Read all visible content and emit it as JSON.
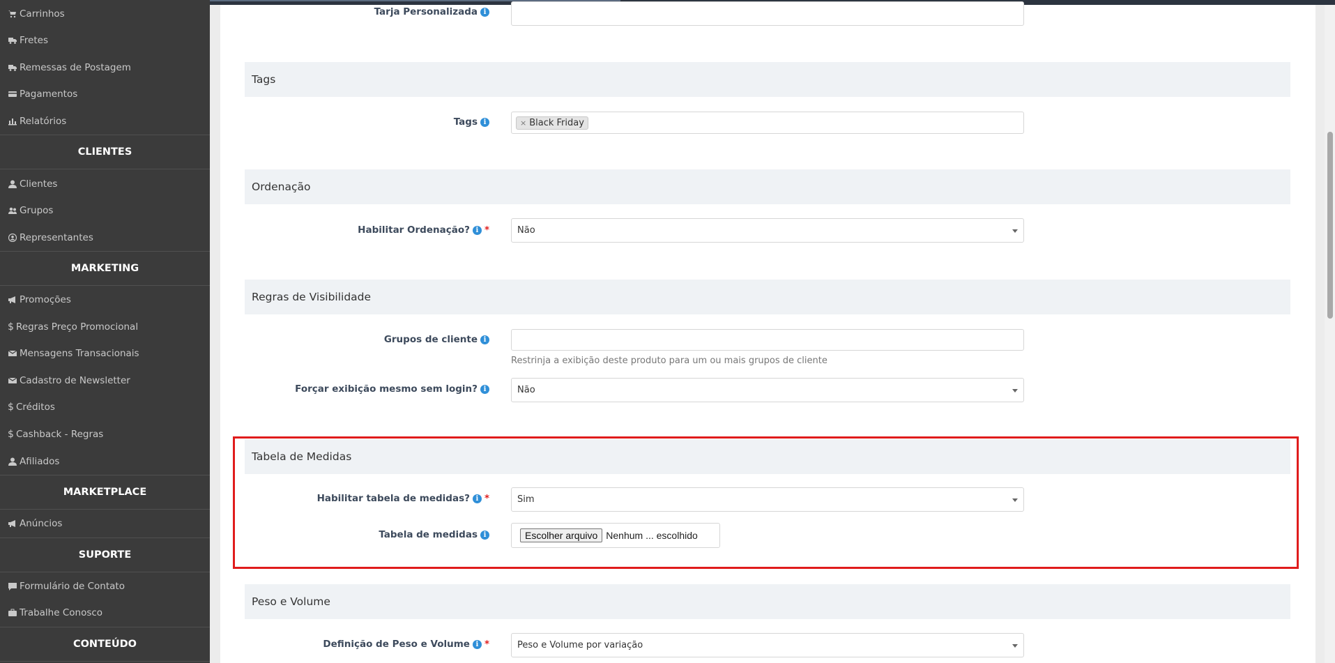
{
  "sidebar": {
    "items_top": [
      {
        "label": "Carrinhos",
        "icon": "cart-icon"
      },
      {
        "label": "Fretes",
        "icon": "truck-icon"
      },
      {
        "label": "Remessas de Postagem",
        "icon": "truck-icon"
      },
      {
        "label": "Pagamentos",
        "icon": "credit-card-icon"
      },
      {
        "label": "Relatórios",
        "icon": "bar-chart-icon"
      }
    ],
    "clientes_header": "CLIENTES",
    "clientes": [
      {
        "label": "Clientes",
        "icon": "user-icon"
      },
      {
        "label": "Grupos",
        "icon": "users-icon"
      },
      {
        "label": "Representantes",
        "icon": "user-circle-icon"
      }
    ],
    "marketing_header": "MARKETING",
    "marketing": [
      {
        "label": "Promoções",
        "icon": "bullhorn-icon"
      },
      {
        "label": "Regras Preço Promocional",
        "icon": "dollar-icon"
      },
      {
        "label": "Mensagens Transacionais",
        "icon": "envelope-icon"
      },
      {
        "label": "Cadastro de Newsletter",
        "icon": "envelope-icon"
      },
      {
        "label": "Créditos",
        "icon": "dollar-icon"
      },
      {
        "label": "Cashback - Regras",
        "icon": "dollar-icon"
      },
      {
        "label": "Afiliados",
        "icon": "user-icon"
      }
    ],
    "marketplace_header": "MARKETPLACE",
    "marketplace": [
      {
        "label": "Anúncios",
        "icon": "bullhorn-icon"
      }
    ],
    "suporte_header": "SUPORTE",
    "suporte": [
      {
        "label": "Formulário de Contato",
        "icon": "comment-icon"
      },
      {
        "label": "Trabalhe Conosco",
        "icon": "briefcase-icon"
      }
    ],
    "conteudo_header": "CONTEÚDO"
  },
  "form": {
    "tarja_label": "Tarja Personalizada",
    "tags_section": "Tags",
    "tags_label": "Tags",
    "tags_value": "Black Friday",
    "tag_remove": "×",
    "ordenacao_section": "Ordenação",
    "habilitar_ordenacao_label": "Habilitar Ordenação?",
    "habilitar_ordenacao_value": "Não",
    "visibilidade_section": "Regras de Visibilidade",
    "grupos_cliente_label": "Grupos de cliente",
    "grupos_cliente_help": "Restrinja a exibição deste produto para um ou mais grupos de cliente",
    "forcar_exibicao_label": "Forçar exibição mesmo sem login?",
    "forcar_exibicao_value": "Não",
    "medidas_section": "Tabela de Medidas",
    "habilitar_medidas_label": "Habilitar tabela de medidas?",
    "habilitar_medidas_value": "Sim",
    "tabela_medidas_label": "Tabela de medidas",
    "file_button": "Escolher arquivo",
    "file_status": "Nenhum ... escolhido",
    "peso_section": "Peso e Volume",
    "definicao_peso_label": "Definição de Peso e Volume",
    "definicao_peso_value": "Peso e Volume por variação",
    "required_mark": "*",
    "info_glyph": "i"
  },
  "colors": {
    "sidebar_bg": "#3b3b3b",
    "section_bg": "#eff2f5",
    "highlight_border": "#e01c1c",
    "info_blue": "#2f8fd8"
  }
}
